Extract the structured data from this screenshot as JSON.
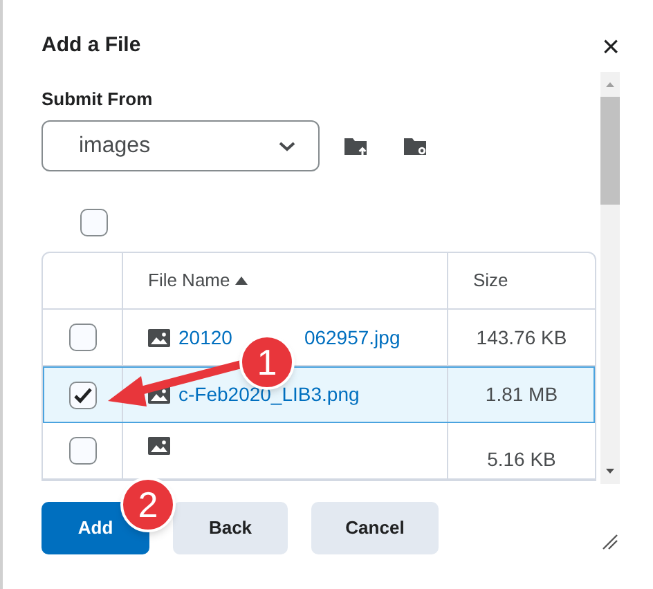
{
  "dialog": {
    "title": "Add a File",
    "close": "×"
  },
  "submit_from": {
    "label": "Submit From",
    "value": "images"
  },
  "select_all": {
    "checked": false
  },
  "table": {
    "columns": [
      {
        "label": "File Name",
        "sorted": true
      },
      {
        "label": "Size",
        "sorted": false
      }
    ],
    "rows": [
      {
        "name_parts": [
          "20120",
          "062957.jpg"
        ],
        "size": "143.76 KB",
        "checked": false,
        "selected": false
      },
      {
        "name_parts": [
          "c-Feb2020_LIB3.png"
        ],
        "size": "1.81 MB",
        "checked": true,
        "selected": true
      },
      {
        "name_parts": [],
        "size": "5.16 KB",
        "checked": false,
        "selected": false
      }
    ]
  },
  "buttons": [
    {
      "label": "Add",
      "kind": "primary"
    },
    {
      "label": "Back",
      "kind": "secondary"
    },
    {
      "label": "Cancel",
      "kind": "secondary"
    }
  ],
  "annotations": [
    {
      "label": "1"
    },
    {
      "label": "2"
    }
  ]
}
